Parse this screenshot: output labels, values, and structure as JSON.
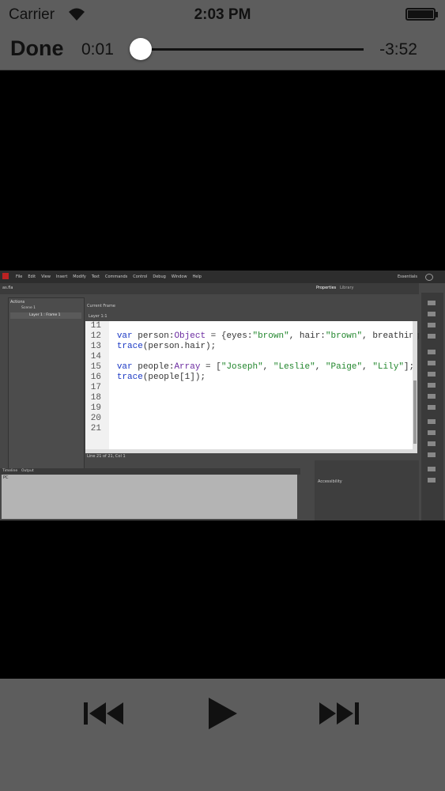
{
  "status_bar": {
    "carrier": "Carrier",
    "time": "2:03 PM"
  },
  "player": {
    "done_label": "Done",
    "elapsed": "0:01",
    "remaining": "-3:52",
    "progress": 0.004
  },
  "video_frame": {
    "menu_items": [
      "File",
      "Edit",
      "View",
      "Insert",
      "Modify",
      "Text",
      "Commands",
      "Control",
      "Debug",
      "Window",
      "Help"
    ],
    "workspace": "Essentials",
    "doc_tab": "as.fla",
    "properties_tab": "Properties",
    "library_tab": "Library",
    "actions_title": "Actions",
    "tree_scene": "Scene 1",
    "tree_layer": "Layer 1 : Frame 1",
    "code_tab": "Current Frame",
    "code_subtab": "Layer 1:1",
    "code_lines": [
      {
        "n": "11",
        "t": ""
      },
      {
        "n": "12",
        "t": "var person:Object = {eyes:\"brown\", hair:\"brown\", breathing:tru"
      },
      {
        "n": "13",
        "t": "trace(person.hair);"
      },
      {
        "n": "14",
        "t": ""
      },
      {
        "n": "15",
        "t": "var people:Array = [\"Joseph\", \"Leslie\", \"Paige\", \"Lily\"];"
      },
      {
        "n": "16",
        "t": "trace(people[1]);"
      },
      {
        "n": "17",
        "t": ""
      },
      {
        "n": "18",
        "t": ""
      },
      {
        "n": "19",
        "t": ""
      },
      {
        "n": "20",
        "t": ""
      },
      {
        "n": "21",
        "t": ""
      }
    ],
    "status_line": "Line 21 of 21, Col 1",
    "timeline_tab": "Timeline",
    "output_tab": "Output",
    "output_text": "PC",
    "accessibility": "Accessibility"
  },
  "controls": {
    "rewind_icon": "skip-back-icon",
    "play_icon": "play-icon",
    "ffwd_icon": "skip-forward-icon"
  }
}
